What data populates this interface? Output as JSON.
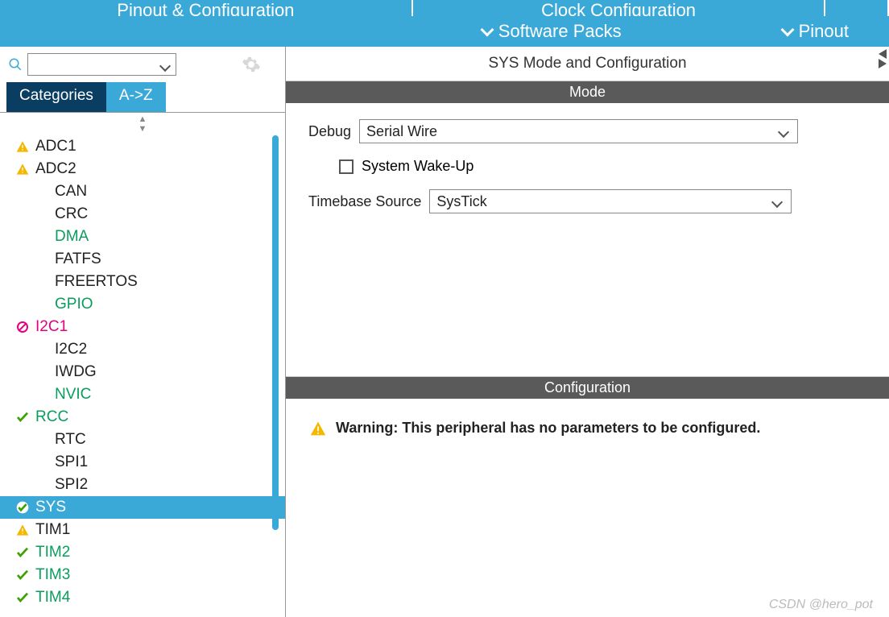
{
  "top_tabs": {
    "pinout": "Pinout & Configuration",
    "clock": "Clock Configuration",
    "third": ""
  },
  "sub_tabs": {
    "software_packs": "Software Packs",
    "pinout": "Pinout"
  },
  "filter_tabs": {
    "categories": "Categories",
    "alpha": "A->Z"
  },
  "peripherals": [
    {
      "name": "ADC1",
      "status": "warning",
      "color": "normal"
    },
    {
      "name": "ADC2",
      "status": "warning",
      "color": "normal"
    },
    {
      "name": "CAN",
      "status": "none",
      "color": "normal"
    },
    {
      "name": "CRC",
      "status": "none",
      "color": "normal"
    },
    {
      "name": "DMA",
      "status": "none",
      "color": "green"
    },
    {
      "name": "FATFS",
      "status": "none",
      "color": "normal"
    },
    {
      "name": "FREERTOS",
      "status": "none",
      "color": "normal"
    },
    {
      "name": "GPIO",
      "status": "none",
      "color": "green"
    },
    {
      "name": "I2C1",
      "status": "error",
      "color": "pink"
    },
    {
      "name": "I2C2",
      "status": "none",
      "color": "normal"
    },
    {
      "name": "IWDG",
      "status": "none",
      "color": "normal"
    },
    {
      "name": "NVIC",
      "status": "none",
      "color": "green"
    },
    {
      "name": "RCC",
      "status": "check",
      "color": "green"
    },
    {
      "name": "RTC",
      "status": "none",
      "color": "normal"
    },
    {
      "name": "SPI1",
      "status": "none",
      "color": "normal"
    },
    {
      "name": "SPI2",
      "status": "none",
      "color": "normal"
    },
    {
      "name": "SYS",
      "status": "check-white",
      "color": "normal",
      "selected": true
    },
    {
      "name": "TIM1",
      "status": "warning",
      "color": "normal"
    },
    {
      "name": "TIM2",
      "status": "check",
      "color": "green"
    },
    {
      "name": "TIM3",
      "status": "check",
      "color": "green"
    },
    {
      "name": "TIM4",
      "status": "check",
      "color": "green"
    }
  ],
  "right": {
    "title": "SYS Mode and Configuration",
    "mode_header": "Mode",
    "config_header": "Configuration",
    "debug_label": "Debug",
    "debug_value": "Serial Wire",
    "wakeup_label": "System Wake-Up",
    "timebase_label": "Timebase Source",
    "timebase_value": "SysTick",
    "warning_text": "Warning: This peripheral has no parameters to be configured."
  },
  "watermark": "CSDN @hero_pot"
}
